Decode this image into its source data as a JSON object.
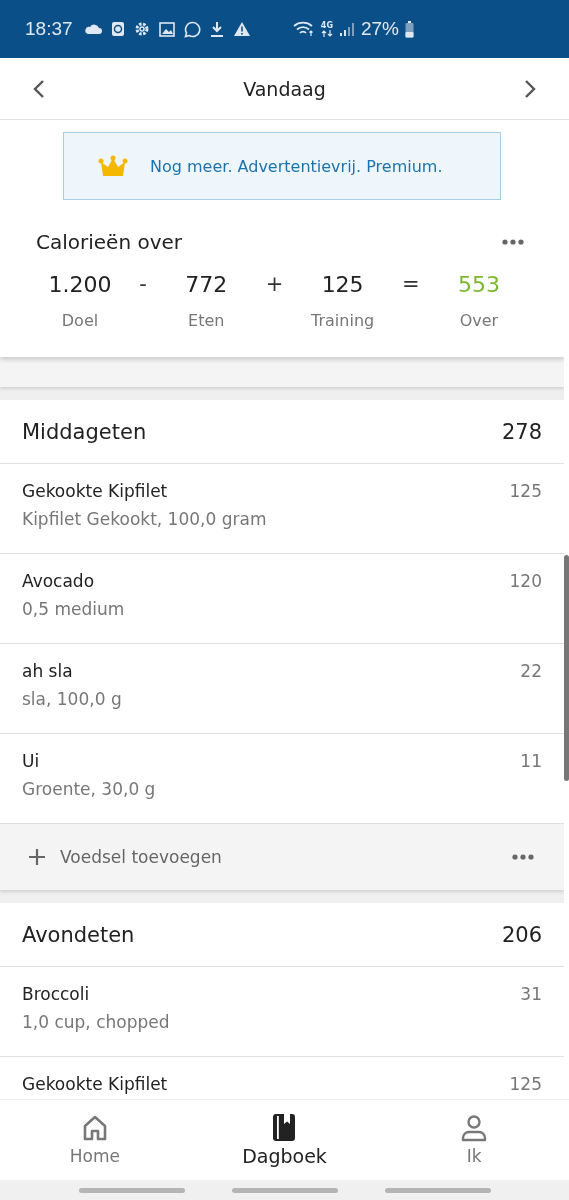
{
  "status_bar": {
    "time": "18:37",
    "network": "4G",
    "battery": "27%"
  },
  "header": {
    "title": "Vandaag"
  },
  "banner": {
    "text": "Nog meer. Advertentievrij. Premium."
  },
  "summary": {
    "title": "Calorieën over",
    "equation": [
      {
        "kind": "value",
        "value": "1.200",
        "label": "Doel"
      },
      {
        "kind": "operator",
        "text": "-"
      },
      {
        "kind": "value",
        "value": "772",
        "label": "Eten"
      },
      {
        "kind": "operator",
        "text": "+"
      },
      {
        "kind": "value",
        "value": "125",
        "label": "Training"
      },
      {
        "kind": "operator",
        "text": "="
      },
      {
        "kind": "result",
        "value": "553",
        "label": "Over"
      }
    ]
  },
  "meals": [
    {
      "title": "Middageten",
      "total": "278",
      "add_label": "Voedsel toevoegen",
      "foods": [
        {
          "name": "Gekookte Kipfilet",
          "detail": "Kipfilet Gekookt, 100,0 gram",
          "calories": "125"
        },
        {
          "name": "Avocado",
          "detail": "0,5 medium",
          "calories": "120"
        },
        {
          "name": "ah sla",
          "detail": "sla, 100,0 g",
          "calories": "22"
        },
        {
          "name": "Ui",
          "detail": "Groente, 30,0 g",
          "calories": "11"
        }
      ]
    },
    {
      "title": "Avondeten",
      "total": "206",
      "foods": [
        {
          "name": "Broccoli",
          "detail": "1,0 cup, chopped",
          "calories": "31"
        },
        {
          "name": "Gekookte Kipfilet",
          "calories": "125"
        }
      ]
    }
  ],
  "bottom_nav": [
    {
      "label": "Home",
      "selected": false
    },
    {
      "label": "Dagboek",
      "selected": true
    },
    {
      "label": "Ik",
      "selected": false
    }
  ]
}
